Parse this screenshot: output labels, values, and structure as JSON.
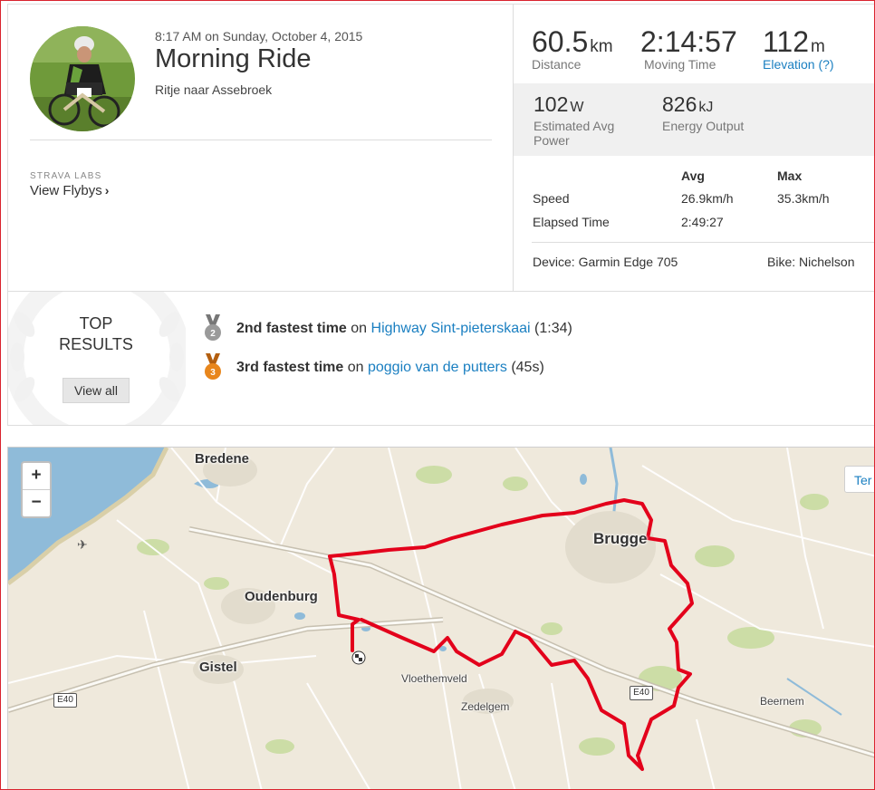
{
  "activity": {
    "datetime": "8:17 AM on Sunday, October 4, 2015",
    "title": "Morning Ride",
    "description": "Ritje naar Assebroek"
  },
  "labs": {
    "label": "STRAVA LABS",
    "flybys": "View Flybys"
  },
  "stats": {
    "distance": {
      "value": "60.5",
      "unit": "km",
      "label": "Distance"
    },
    "moving_time": {
      "value": "2:14:57",
      "label": "Moving Time"
    },
    "elevation": {
      "value": "112",
      "unit": "m",
      "label": "Elevation (?)"
    },
    "power": {
      "value": "102",
      "unit": "W",
      "label": "Estimated Avg Power"
    },
    "energy": {
      "value": "826",
      "unit": "kJ",
      "label": "Energy Output"
    },
    "table": {
      "col_avg": "Avg",
      "col_max": "Max",
      "rows": [
        {
          "label": "Speed",
          "avg": "26.9km/h",
          "max": "35.3km/h"
        },
        {
          "label": "Elapsed Time",
          "avg": "2:49:27",
          "max": ""
        }
      ]
    },
    "device": "Device: Garmin Edge 705",
    "bike": "Bike: Nichelson"
  },
  "top_results": {
    "title_line1": "TOP",
    "title_line2": "RESULTS",
    "view_all": "View all",
    "items": [
      {
        "rank_text": "2nd fastest time",
        "on": "on",
        "segment": "Highway Sint-pieterskaai",
        "time": "(1:34)",
        "medal_number": "2",
        "medal_color": "#9a9a9a"
      },
      {
        "rank_text": "3rd fastest time",
        "on": "on",
        "segment": "poggio van de putters",
        "time": "(45s)",
        "medal_number": "3",
        "medal_color": "#e8861c"
      }
    ]
  },
  "map": {
    "zoom_in": "+",
    "zoom_out": "−",
    "terrain_tab": "Ter",
    "places": {
      "bredene": "Bredene",
      "oudenburg": "Oudenburg",
      "gistel": "Gistel",
      "brugge": "Brugge",
      "vloethemveld": "Vloethemveld",
      "zedelgem": "Zedelgem",
      "beernem": "Beernem"
    },
    "road_e40_a": "E40",
    "road_e40_b": "E40",
    "route_color": "#e3001b",
    "sea_color": "#8fbbd9"
  }
}
